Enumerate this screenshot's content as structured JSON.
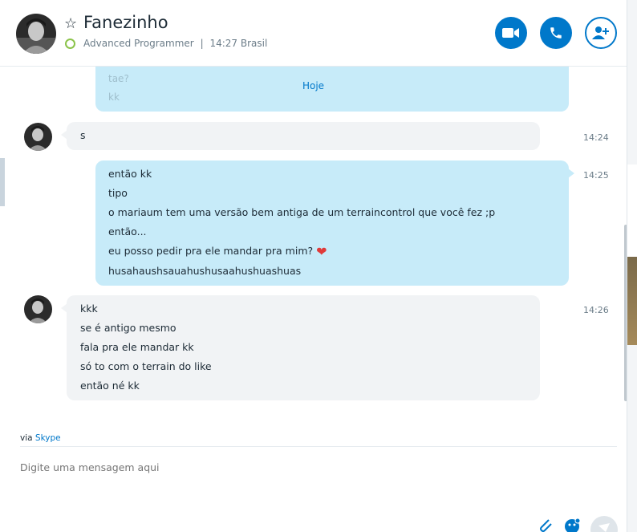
{
  "header": {
    "name": "Fanezinho",
    "mood": "Advanced Programmer",
    "separator": "|",
    "local_time": "14:27 Brasil"
  },
  "chat": {
    "previous_lines": [
      "tae?",
      "kk"
    ],
    "date_divider": "Hoje",
    "messages": [
      {
        "direction": "in",
        "time": "14:24",
        "lines": [
          "s"
        ]
      },
      {
        "direction": "out",
        "time": "14:25",
        "lines": [
          "então kk",
          "tipo",
          "o mariaum tem uma versão bem antiga de um terraincontrol que você fez ;p",
          "então...",
          "eu posso pedir pra ele mandar pra mim?",
          "husahaushsauahushusaahushuashuas"
        ],
        "emoji": "❤"
      },
      {
        "direction": "in",
        "time": "14:26",
        "lines": [
          "kkk",
          "se é antigo mesmo",
          "fala pra ele mandar kk",
          "só to com o terrain do like",
          "então né kk"
        ]
      }
    ]
  },
  "footer": {
    "via_prefix": "via",
    "via_link": "Skype",
    "compose_placeholder": "Digite uma mensagem aqui"
  },
  "colors": {
    "accent": "#0078ca",
    "outgoing_bubble": "#c7ebf9",
    "incoming_bubble": "#f1f3f5",
    "status_online": "#8bc34a"
  }
}
